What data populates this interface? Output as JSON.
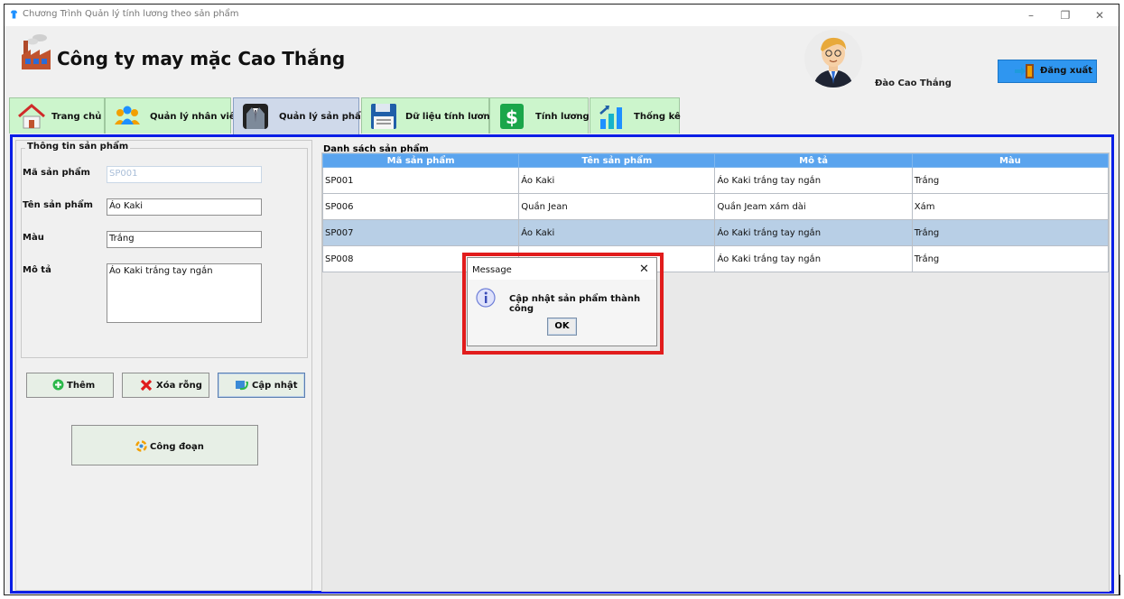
{
  "window": {
    "title": "Chương Trình Quản lý tính lương theo sản phẩm"
  },
  "header": {
    "company": "Công ty may mặc Cao Thắng",
    "user_name": "Đào Cao Thắng",
    "logout_label": "Đăng xuất"
  },
  "tabs": [
    {
      "label": "Trang chủ",
      "icon": "home-icon"
    },
    {
      "label": "Quản lý nhân viên",
      "icon": "people-icon"
    },
    {
      "label": "Quản lý sản phẩm",
      "icon": "suit-icon",
      "active": true
    },
    {
      "label": "Dữ liệu tính lương",
      "icon": "floppy-icon"
    },
    {
      "label": "Tính lương",
      "icon": "dollar-icon"
    },
    {
      "label": "Thống kê",
      "icon": "bar-chart-icon"
    }
  ],
  "form": {
    "group_title": "Thông tin sản phẩm",
    "code_label": "Mã sản phẩm",
    "code_value": "SP001",
    "name_label": "Tên sản phẩm",
    "name_value": "Áo Kaki",
    "color_label": "Màu",
    "color_value": "Trắng",
    "desc_label": "Mô tả",
    "desc_value": "Áo Kaki trắng tay ngắn"
  },
  "buttons": {
    "add": "Thêm",
    "clear": "Xóa rỗng",
    "update": "Cập nhật",
    "stage": "Công đoạn"
  },
  "list": {
    "group_title": "Danh sách sản phẩm",
    "columns": [
      "Mã sản phẩm",
      "Tên sản phẩm",
      "Mô tả",
      "Màu"
    ],
    "rows": [
      [
        "SP001",
        "Áo Kaki",
        "Áo Kaki trắng tay ngắn",
        "Trắng"
      ],
      [
        "SP006",
        "Quần Jean",
        "Quần Jeam xám dài",
        "Xám"
      ],
      [
        "SP007",
        "Áo Kaki",
        "Áo Kaki trắng tay ngắn",
        "Trắng"
      ],
      [
        "SP008",
        "",
        "Áo Kaki trắng tay ngắn",
        "Trắng"
      ]
    ],
    "selected_row": 2
  },
  "dialog": {
    "title": "Message",
    "message": "Cập nhật sản phẩm thành công",
    "ok_label": "OK"
  },
  "colors": {
    "accent_border": "#0a1ee6",
    "highlight_frame": "#e11c1c",
    "table_header": "#5aa4ee",
    "tab_bg": "#ccf5cc"
  }
}
